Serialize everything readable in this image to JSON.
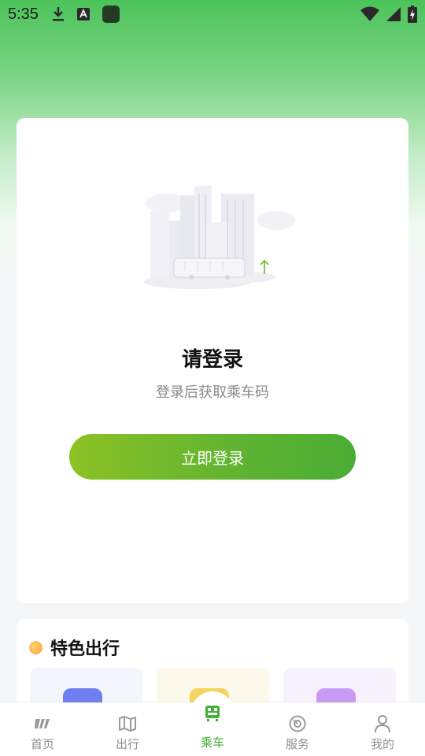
{
  "status_bar": {
    "time": "5:35",
    "left_icons": [
      "download-icon",
      "text-a-icon",
      "app-square-icon"
    ],
    "right_icons": [
      "wifi-icon",
      "signal-icon",
      "battery-charging-icon"
    ]
  },
  "login_card": {
    "title": "请登录",
    "subtitle": "登录后获取乘车码",
    "button_label": "立即登录",
    "illustration": "city-bus-illustration"
  },
  "features": {
    "title": "特色出行",
    "tiles": [
      {
        "icon": "ticket-icon",
        "bg": "#f4f6fe",
        "icon_color": "#6f7ff0"
      },
      {
        "icon": "card-icon",
        "bg": "#fdf9ea",
        "icon_color": "#f4d35e"
      },
      {
        "icon": "flower-icon",
        "bg": "#f7f2fd",
        "icon_color": "#c99af4"
      }
    ]
  },
  "bottom_nav": {
    "items": [
      {
        "label": "首页",
        "icon": "home-icon"
      },
      {
        "label": "出行",
        "icon": "map-icon"
      },
      {
        "label": "乘车",
        "icon": "qr-bus-icon",
        "active": true
      },
      {
        "label": "服务",
        "icon": "service-icon"
      },
      {
        "label": "我的",
        "icon": "profile-icon"
      }
    ]
  },
  "colors": {
    "accent": "#44b035",
    "button_start": "#8cc224",
    "button_end": "#49ad33",
    "header_green": "#4cc35a"
  }
}
